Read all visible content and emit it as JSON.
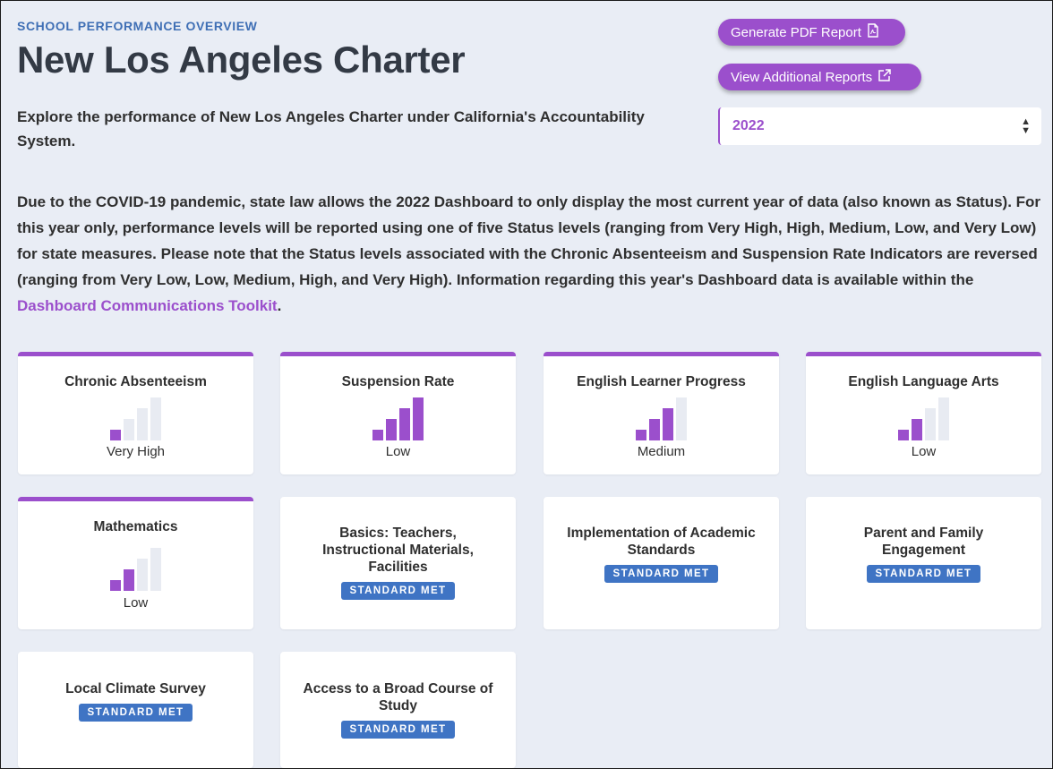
{
  "header": {
    "eyebrow": "SCHOOL PERFORMANCE OVERVIEW",
    "title": "New Los Angeles Charter",
    "intro": "Explore the performance of New Los Angeles Charter under California's Accountability System."
  },
  "actions": {
    "pdf_label": "Generate PDF Report",
    "reports_label": "View Additional Reports",
    "year_selected": "2022"
  },
  "notice": {
    "text": "Due to the COVID-19 pandemic, state law allows the 2022 Dashboard to only display the most current year of data (also known as Status). For this year only, performance levels will be reported using one of five Status levels (ranging from Very High, High, Medium, Low, and Very Low) for state measures. Please note that the Status levels associated with the Chronic Absenteeism and Suspension Rate Indicators are reversed (ranging from Very Low, Low, Medium, High, and Very High). Information regarding this year's Dashboard data is available within the ",
    "link": "Dashboard Communications Toolkit",
    "end": "."
  },
  "indicators": [
    {
      "title": "Chronic Absenteeism",
      "level": "Very High",
      "bars_filled": 1
    },
    {
      "title": "Suspension Rate",
      "level": "Low",
      "bars_filled": 4
    },
    {
      "title": "English Learner Progress",
      "level": "Medium",
      "bars_filled": 3
    },
    {
      "title": "English Language Arts",
      "level": "Low",
      "bars_filled": 2
    },
    {
      "title": "Mathematics",
      "level": "Low",
      "bars_filled": 2
    }
  ],
  "local": [
    {
      "title_line1": "Basics: Teachers,",
      "title_line2": "Instructional Materials,",
      "title_line3": "Facilities",
      "status": "STANDARD MET"
    },
    {
      "title_line1": "Implementation of Academic",
      "title_line2": "Standards",
      "status": "STANDARD MET"
    },
    {
      "title_line1": "Parent and Family",
      "title_line2": "Engagement",
      "status": "STANDARD MET"
    },
    {
      "title_line1": "Local Climate Survey",
      "status": "STANDARD MET"
    },
    {
      "title_line1": "Access to a Broad Course of",
      "title_line2": "Study",
      "status": "STANDARD MET"
    }
  ],
  "colors": {
    "accent": "#9b4fcc",
    "badge": "#3f74c4",
    "bar_empty": "#e8ebf2"
  },
  "icons": {
    "pdf": "document-icon",
    "external": "external-link-icon",
    "select": "sort-arrows-icon"
  }
}
